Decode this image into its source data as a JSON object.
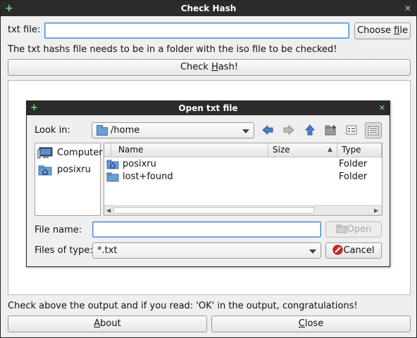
{
  "window": {
    "title": "Check Hash",
    "plus_icon": "plus-icon",
    "close_icon": "close-icon"
  },
  "txt_row": {
    "label": "txt file:",
    "value": "",
    "choose_prefix": "Choose ",
    "choose_accel": "f",
    "choose_suffix": "ile"
  },
  "hint": "The txt hashs file needs to be in a folder with the iso file to be checked!",
  "check_button": {
    "prefix": "Check ",
    "accel": "H",
    "suffix": "ash!"
  },
  "dialog": {
    "title": "Open txt file",
    "look_in_label": "Look in:",
    "look_in_value": "/home",
    "toolbar_icons": [
      "back-arrow-icon",
      "forward-arrow-icon",
      "up-arrow-icon",
      "new-folder-icon",
      "list-view-icon",
      "detail-view-icon"
    ],
    "sidebar": [
      {
        "label": "Computer",
        "icon": "computer-icon"
      },
      {
        "label": "posixru",
        "icon": "home-folder-icon"
      }
    ],
    "columns": {
      "name": "Name",
      "size": "Size",
      "type": "Type"
    },
    "files": [
      {
        "name": "posixru",
        "size": "",
        "type": "Folder",
        "icon": "home-folder-icon"
      },
      {
        "name": "lost+found",
        "size": "",
        "type": "Folder",
        "icon": "folder-icon"
      }
    ],
    "file_name_label": "File name:",
    "file_name_value": "",
    "open_button": "Open",
    "files_of_type_label": "Files of type:",
    "files_of_type_value": "*.txt",
    "cancel_button": "Cancel"
  },
  "footer_text": "Check above the output and if you read: 'OK' in the output, congratulations!",
  "about_button": {
    "accel": "A",
    "suffix": "bout"
  },
  "close_button": {
    "accel": "C",
    "suffix": "lose"
  },
  "colors": {
    "titlebar": "#2b2b2b",
    "focus": "#4a8fd8",
    "folder": "#6a9fd4",
    "cancel_red": "#d42a2a"
  }
}
